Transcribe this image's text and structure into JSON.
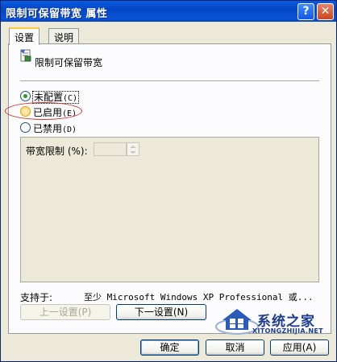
{
  "window": {
    "title": "限制可保留带宽 属性",
    "help_symbol": "?",
    "close_symbol": "✕"
  },
  "tabs": [
    {
      "label": "设置",
      "active": true
    },
    {
      "label": "说明",
      "active": false
    }
  ],
  "policy": {
    "name": "限制可保留带宽",
    "icon": "policy-setting-icon"
  },
  "radios": [
    {
      "label": "未配置",
      "mnemonic": "(C)",
      "selected": true
    },
    {
      "label": "已启用",
      "mnemonic": "(E)",
      "selected": false
    },
    {
      "label": "已禁用",
      "mnemonic": "(D)",
      "selected": false
    }
  ],
  "options": {
    "bandwidth_label": "带宽限制 (%):",
    "bandwidth_value": ""
  },
  "supported": {
    "label": "支持于:",
    "value": "至少 Microsoft Windows XP Professional 或..."
  },
  "buttons": {
    "prev": "上一设置(P)",
    "next": "下一设置(N)",
    "ok": "确定",
    "cancel": "取消",
    "apply": "应用(A)"
  },
  "watermark": {
    "brand": "系统之家",
    "url": "XITONGZHIJIA.NET"
  },
  "colors": {
    "titlebar": "#0a52d8",
    "dialog_bg": "#ece9d8",
    "annotation_red": "#d03030",
    "watermark": "#1e3c8c"
  }
}
